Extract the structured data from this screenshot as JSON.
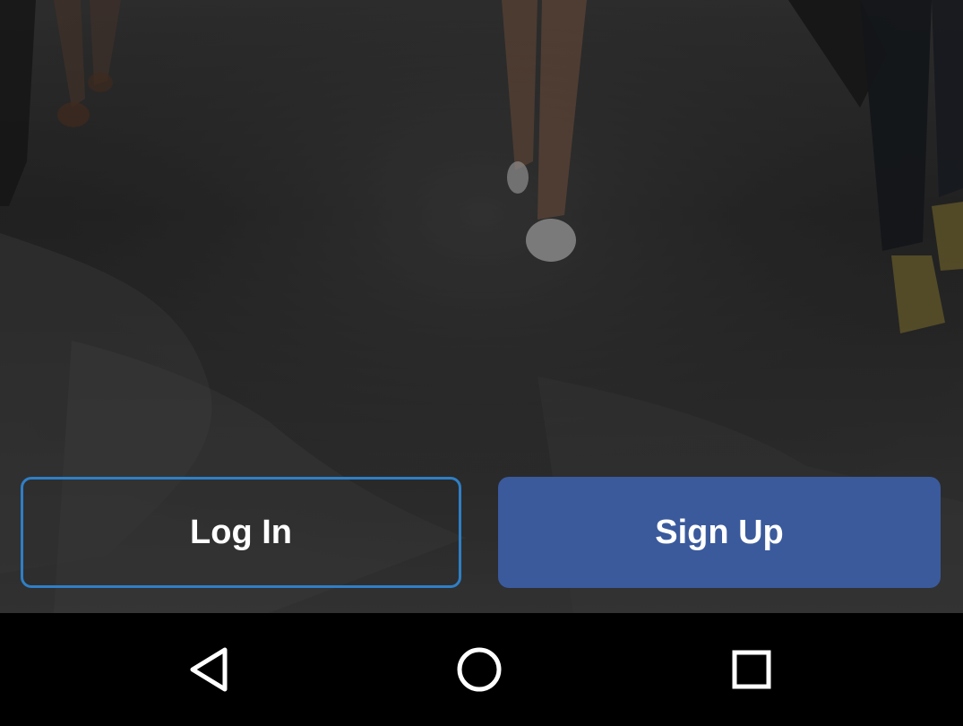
{
  "colors": {
    "signup_bg": "#3a5a9c",
    "login_border": "#2f7fc6",
    "button_text": "#ffffff",
    "navbar_bg": "#000000",
    "nav_icon": "#ffffff"
  },
  "hero": {
    "icon": "people-walking-photo"
  },
  "actions": {
    "login_label": "Log In",
    "signup_label": "Sign Up"
  },
  "navbar": {
    "back_icon": "back-triangle-icon",
    "home_icon": "home-circle-icon",
    "recents_icon": "recents-square-icon"
  }
}
